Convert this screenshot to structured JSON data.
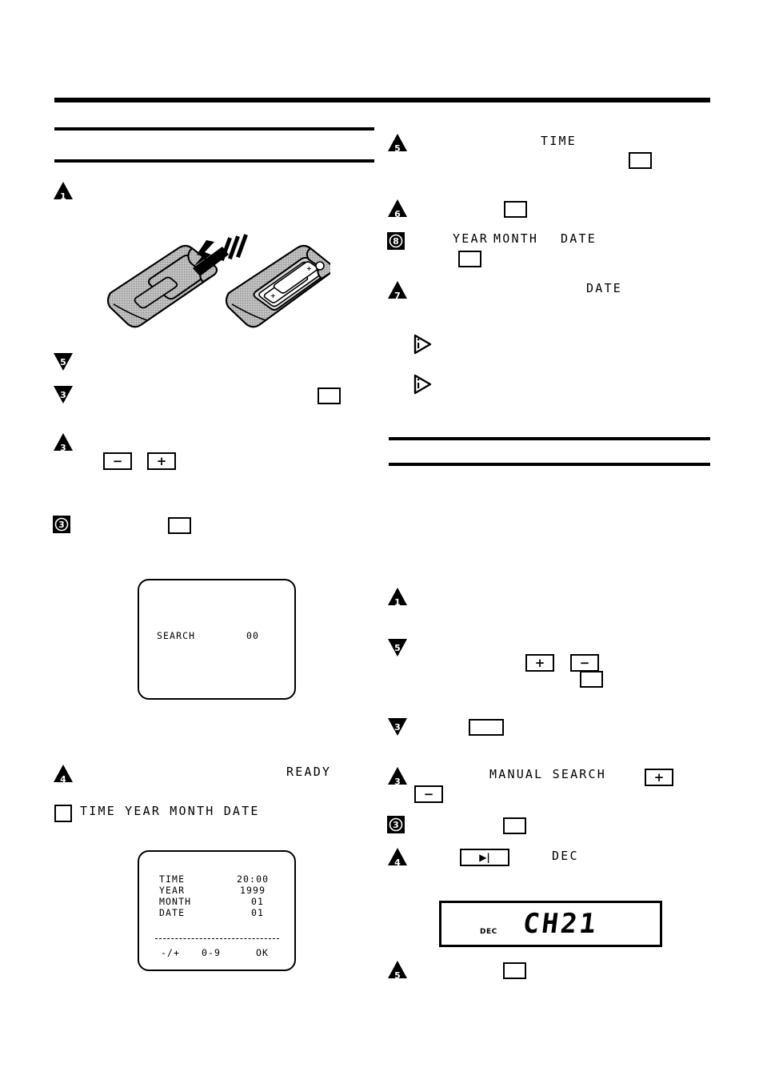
{
  "page": {
    "type": "vcr-instruction-manual-page",
    "background": "#ffffff",
    "ink_color": "#000000"
  },
  "rules": {
    "top_header_rule": "",
    "left_section_rule_upper": "",
    "left_section_rule_lower": "",
    "right_section_rule_upper": "",
    "right_section_rule_lower": ""
  },
  "left_column": {
    "steps": [
      {
        "marker": "1",
        "marker_style": "up-triangle",
        "text": ""
      },
      {
        "marker": "5",
        "marker_style": "down-triangle",
        "text": ""
      },
      {
        "marker": "3",
        "marker_style": "down-triangle",
        "text": ""
      },
      {
        "marker": "3",
        "marker_style": "up-triangle",
        "text": ""
      },
      {
        "marker": "3",
        "marker_style": "square-circle",
        "text": ""
      },
      {
        "marker": "4",
        "marker_style": "up-triangle",
        "text": ""
      }
    ],
    "keywords": {
      "ready": "READY",
      "time_year_month_date": "TIME YEAR MONTH DATE"
    },
    "buttons": {
      "minus": "−",
      "plus": "+",
      "blank_a": "",
      "blank_b": ""
    },
    "checkbox_bullet": "",
    "illustration": {
      "name": "remote-control-battery-compartment",
      "caption": ""
    },
    "screen_search": {
      "label": "SEARCH",
      "value": "00"
    },
    "screen_clock": {
      "rows": [
        {
          "label": "TIME",
          "value": "20:00"
        },
        {
          "label": "YEAR",
          "value": "1999"
        },
        {
          "label": "MONTH",
          "value": "01"
        },
        {
          "label": "DATE",
          "value": "01"
        }
      ],
      "footer": [
        "-/+",
        "0-9",
        "OK"
      ]
    }
  },
  "right_column": {
    "steps": [
      {
        "marker": "5",
        "marker_style": "up-triangle",
        "text": ""
      },
      {
        "marker": "6",
        "marker_style": "up-triangle",
        "text": ""
      },
      {
        "marker": "8",
        "marker_style": "square-circle",
        "text": ""
      },
      {
        "marker": "7",
        "marker_style": "up-triangle",
        "text": ""
      },
      {
        "marker": "1",
        "marker_style": "up-triangle",
        "text": ""
      },
      {
        "marker": "5",
        "marker_style": "down-triangle",
        "text": ""
      },
      {
        "marker": "3",
        "marker_style": "down-triangle",
        "text": ""
      },
      {
        "marker": "3",
        "marker_style": "up-triangle",
        "text": ""
      },
      {
        "marker": "3",
        "marker_style": "square-circle",
        "text": ""
      },
      {
        "marker": "4",
        "marker_style": "up-triangle",
        "text": ""
      },
      {
        "marker": "5",
        "marker_style": "up-triangle",
        "text": ""
      }
    ],
    "note_markers": [
      {
        "style": "right-triangle-outline",
        "text": ""
      },
      {
        "style": "right-triangle-outline",
        "text": ""
      }
    ],
    "keywords": {
      "time": "TIME",
      "year": "YEAR",
      "month": "MONTH",
      "date_1": "DATE",
      "date_2": "DATE",
      "manual_search": "MANUAL SEARCH",
      "dec": "DEC"
    },
    "buttons": {
      "blank_a": "",
      "blank_b": "",
      "blank_c": "",
      "plus_1": "+",
      "minus_1": "−",
      "blank_d": "",
      "blank_e": "",
      "plus_2": "+",
      "minus_2": "−",
      "blank_f": "",
      "play_to_end": "▶|",
      "blank_g": ""
    },
    "lcd_display": {
      "indicator": "DEC",
      "segment_text": "CH21"
    }
  }
}
